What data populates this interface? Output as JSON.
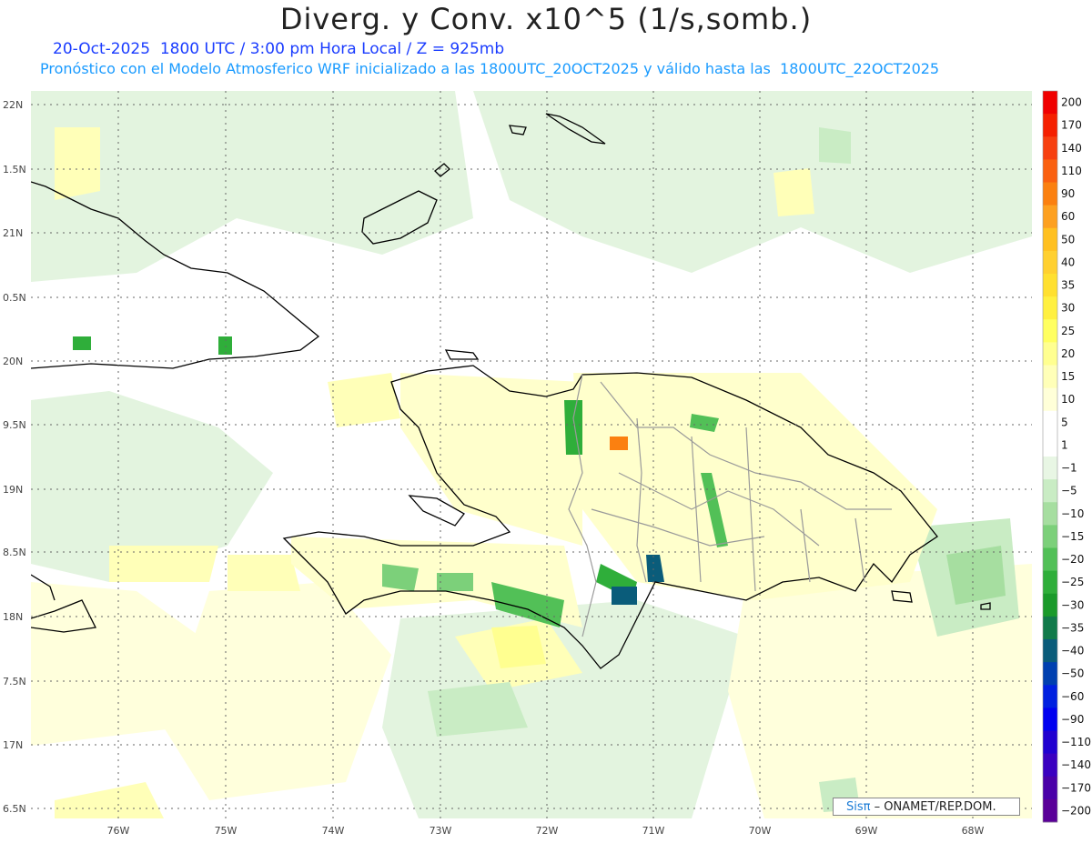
{
  "header": {
    "title": "Diverg. y Conv. x10^5 (1/s,somb.)",
    "date_line": "20-Oct-2025  1800 UTC / 3:00 pm Hora Local / Z = 925mb",
    "model_line": "Pronóstico con el Modelo Atmosferico WRF inicializado a las 1800UTC_20OCT2025 y válido hasta las  1800UTC_22OCT2025"
  },
  "axes": {
    "lat_labels": [
      "22N",
      "1.5N",
      "21N",
      "0.5N",
      "20N",
      "9.5N",
      "19N",
      "8.5N",
      "18N",
      "7.5N",
      "17N",
      "6.5N"
    ],
    "lon_labels": [
      "76W",
      "75W",
      "74W",
      "73W",
      "72W",
      "71W",
      "70W",
      "69W",
      "68W"
    ]
  },
  "colorbar": {
    "labels": [
      "200",
      "170",
      "140",
      "110",
      "90",
      "60",
      "50",
      "40",
      "35",
      "30",
      "25",
      "20",
      "15",
      "10",
      "5",
      "1",
      "−1",
      "−5",
      "−10",
      "−15",
      "−20",
      "−25",
      "−30",
      "−35",
      "−40",
      "−50",
      "−60",
      "−90",
      "−110",
      "−140",
      "−170",
      "−200"
    ],
    "colors": [
      "#f00000",
      "#f52000",
      "#f74010",
      "#fa6010",
      "#fb8010",
      "#fda020",
      "#ffc020",
      "#ffd030",
      "#ffe030",
      "#fff040",
      "#ffff60",
      "#ffff90",
      "#ffffb8",
      "#ffffd8",
      "#ffffff",
      "#ffffff",
      "#e8f6e4",
      "#c9ecc4",
      "#a6dea0",
      "#7cd07a",
      "#52c057",
      "#2fae3a",
      "#1a9a2a",
      "#117a4a",
      "#0a5c7a",
      "#0040b0",
      "#0020e0",
      "#0000f0",
      "#2000d0",
      "#3a00c0",
      "#4a00a8",
      "#5a0098"
    ]
  },
  "credit": {
    "brand": "Sisπ",
    "text": " – ONAMET/REP.DOM."
  },
  "colors": {
    "coastline": "#000000",
    "province_borders": "#9a9a9a",
    "grid": "#666666",
    "convergence_light": "#c9ecc4",
    "convergence_strong": "#2fae3a",
    "divergence_light": "#ffffb8",
    "divergence_strong": "#ffe030"
  }
}
